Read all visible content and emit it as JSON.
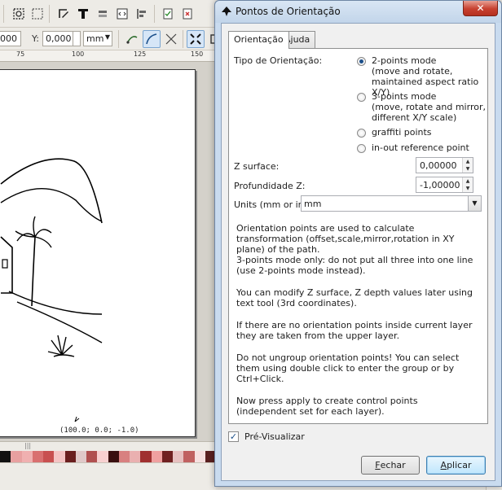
{
  "toolbar": {
    "x_value": "000",
    "y_label": "Y:",
    "y_value": "0,000",
    "unit": "mm"
  },
  "ruler": {
    "ticks": [
      "75",
      "100",
      "125",
      "150"
    ]
  },
  "canvas": {
    "coord_label": "(100.0; 0.0; -1.0)"
  },
  "palette": [
    "#111111",
    "#e8a0a0",
    "#f0b0b0",
    "#d97070",
    "#c85050",
    "#f4c4c4",
    "#6a1e1e",
    "#e0c8c8",
    "#b05050",
    "#f8d0d0",
    "#3a1010",
    "#d88080",
    "#eab0b0",
    "#a03030",
    "#f0a0a0",
    "#702020",
    "#e7c0c0",
    "#c06060",
    "#f6e0e0",
    "#5a2020"
  ],
  "dialog": {
    "title": "Pontos de Orientação",
    "close_symbol": "✕",
    "tabs": [
      {
        "label": "Orientação",
        "active": true
      },
      {
        "label": "Ajuda",
        "active": false
      }
    ],
    "orientation_type_label": "Tipo de Orientação:",
    "options": [
      {
        "label": "2-points mode\n(move and rotate,\nmaintained aspect ratio X/Y)",
        "selected": true
      },
      {
        "label": "3-points mode\n(move, rotate and mirror,\ndifferent X/Y scale)",
        "selected": false
      },
      {
        "label": "graffiti points",
        "selected": false
      },
      {
        "label": "in-out reference point",
        "selected": false
      }
    ],
    "z_surface_label": "Z surface:",
    "z_surface_value": "0,00000",
    "z_depth_label": "Profundidade Z:",
    "z_depth_value": "-1,00000",
    "units_label": "Units (mm or in):",
    "units_value": "mm",
    "info_paragraphs": [
      "Orientation points are used to calculate transformation (offset,scale,mirror,rotation in XY plane) of the path.\n3-points mode only: do not put all three into one line (use 2-points mode instead).",
      "You can modify Z surface, Z depth values later using text tool (3rd coordinates).",
      "If there are no orientation points inside current layer they are taken from the upper layer.",
      "Do not ungroup orientation points! You can select them using double click to enter the group or by Ctrl+Click.",
      "Now press apply to create control points (independent set for each layer)."
    ],
    "preview_label": "Pré-Visualizar",
    "preview_checked": true,
    "close_button": {
      "first": "F",
      "rest": "echar"
    },
    "apply_button": {
      "first": "A",
      "rest": "plicar"
    }
  }
}
